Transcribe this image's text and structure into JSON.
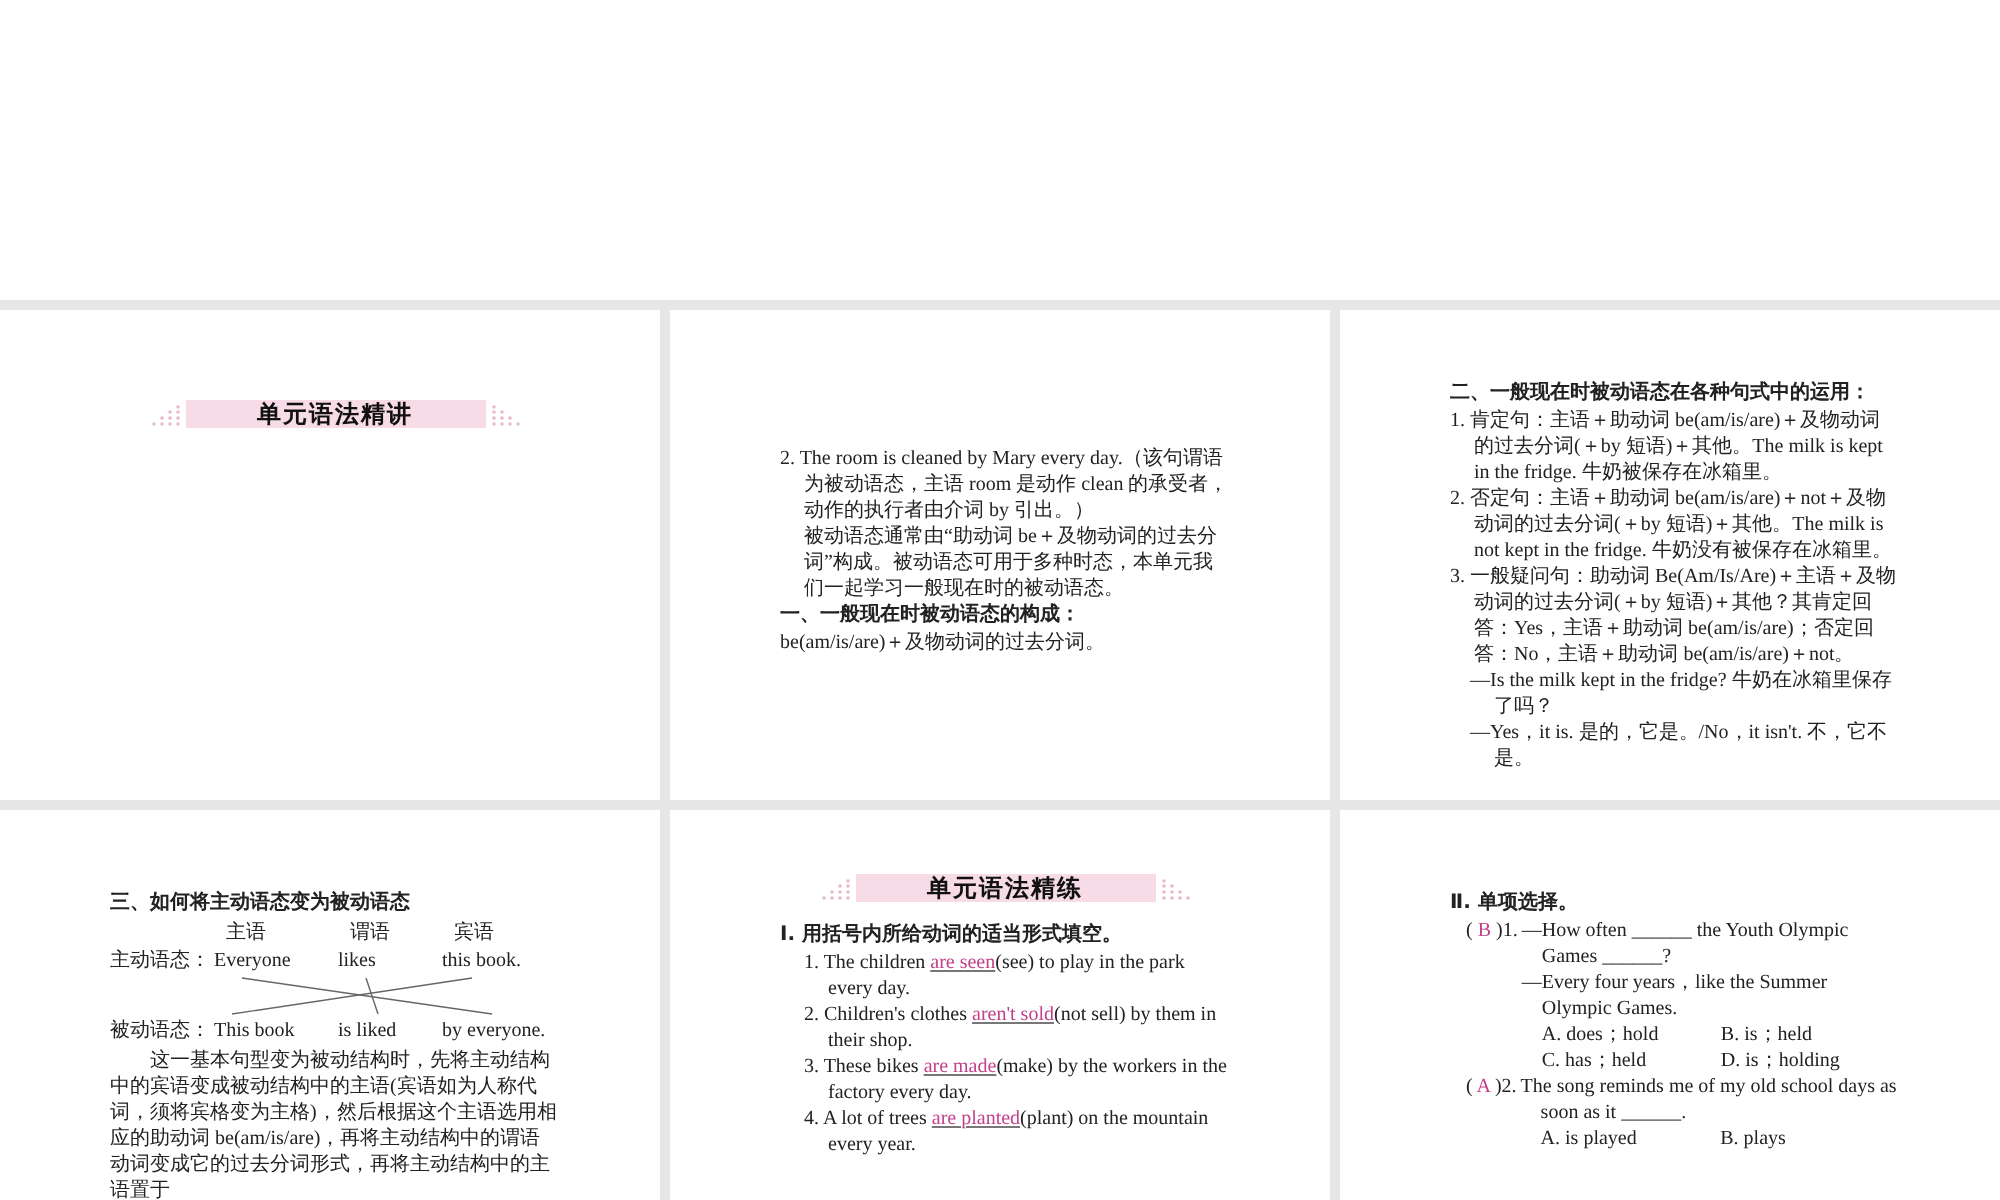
{
  "slides": [
    {
      "blocks": [
        {
          "kind": "banner",
          "text": "单元语法精讲"
        }
      ]
    },
    {
      "blocks": [
        {
          "kind": "item",
          "text": "2. The room is cleaned by Mary every day.（该句谓语为被动语态，主语 room 是动作 clean 的承受者，动作的执行者由介词 by 引出。）"
        },
        {
          "kind": "note",
          "text": "被动语态通常由“助动词 be＋及物动词的过去分词”构成。被动语态可用于多种时态，本单元我们一起学习一般现在时的被动语态。"
        },
        {
          "kind": "heading",
          "text": "一、一般现在时被动语态的构成："
        },
        {
          "kind": "plain",
          "text": "be(am/is/are)＋及物动词的过去分词。"
        }
      ]
    },
    {
      "blocks": [
        {
          "kind": "heading",
          "text": "二、一般现在时被动语态在各种句式中的运用："
        },
        {
          "kind": "item",
          "text": "1. 肯定句：主语＋助动词 be(am/is/are)＋及物动词的过去分词(＋by 短语)＋其他。The milk is kept in the fridge. 牛奶被保存在冰箱里。"
        },
        {
          "kind": "item",
          "text": "2. 否定句：主语＋助动词 be(am/is/are)＋not＋及物动词的过去分词(＋by 短语)＋其他。The milk is not kept in the fridge. 牛奶没有被保存在冰箱里。"
        },
        {
          "kind": "item",
          "text": "3. 一般疑问句：助动词 Be(Am/Is/Are)＋主语＋及物动词的过去分词(＋by 短语)＋其他？其肯定回答：Yes，主语＋助动词 be(am/is/are)；否定回答：No，主语＋助动词 be(am/is/are)＋not。"
        },
        {
          "kind": "dialog",
          "text": "—Is the milk kept in the fridge? 牛奶在冰箱里保存了吗？"
        },
        {
          "kind": "dialog",
          "text": "—Yes，it is. 是的，它是。/No，it isn't. 不，它不是。"
        }
      ]
    },
    {
      "blocks": [
        {
          "kind": "heading",
          "text": "三、如何将主动语态变为被动语态"
        },
        {
          "kind": "diagram",
          "roles": [
            "主语",
            "谓语",
            "宾语"
          ],
          "active": {
            "label": "主动语态：",
            "words": [
              "Everyone",
              "likes",
              "this book."
            ]
          },
          "passive": {
            "label": "被动语态：",
            "words": [
              "This book",
              "is liked",
              "by everyone."
            ]
          }
        },
        {
          "kind": "para",
          "text": "这一基本句型变为被动结构时，先将主动结构中的宾语变成被动结构中的主语(宾语如为人称代词，须将宾格变为主格)，然后根据这个主语选用相应的助动词 be(am/is/are)，再将主动结构中的谓语动词变成它的过去分词形式，再将主动结构中的主语置于"
        }
      ]
    },
    {
      "blocks": [
        {
          "kind": "banner",
          "text": "单元语法精练"
        },
        {
          "kind": "heading",
          "text": "Ⅰ. 用括号内所给动词的适当形式填空。"
        },
        {
          "kind": "fill",
          "number": "1.",
          "before": "The children ",
          "answer": "are seen",
          "after": "(see) to play in the park every day."
        },
        {
          "kind": "fill",
          "number": "2.",
          "before": "Children's clothes ",
          "answer": "aren't sold",
          "after": "(not sell) by them in their shop."
        },
        {
          "kind": "fill",
          "number": "3.",
          "before": "These bikes ",
          "answer": "are made",
          "after": "(make) by the workers in the factory every day."
        },
        {
          "kind": "fill",
          "number": "4.",
          "before": "A lot of trees ",
          "answer": "are planted",
          "after": "(plant) on the mountain every year."
        }
      ]
    },
    {
      "blocks": [
        {
          "kind": "heading",
          "text": "Ⅱ. 单项选择。"
        },
        {
          "kind": "choice",
          "open": "(",
          "answer": "B",
          "close": ")",
          "number": "1.",
          "lines": [
            "—How often ______ the Youth Olympic Games ______?",
            "—Every four years，like the Summer Olympic Games."
          ],
          "options": [
            "A. does；hold",
            "B. is；held",
            "C. has；held",
            "D. is；holding"
          ]
        },
        {
          "kind": "choice",
          "open": "(",
          "answer": "A",
          "close": ")",
          "number": "2.",
          "lines": [
            "The song reminds me of my old school days as soon as it ______."
          ],
          "options": [
            "A. is played",
            "B. plays"
          ]
        }
      ]
    }
  ]
}
